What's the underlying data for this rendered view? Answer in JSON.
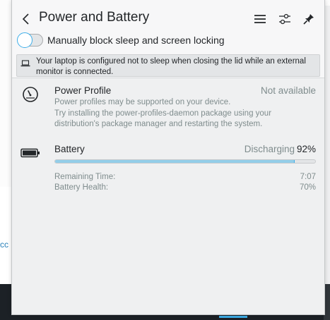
{
  "background": {
    "left_text": "cc"
  },
  "header": {
    "title": "Power and Battery",
    "back_icon": "chevron-left-icon",
    "menu_icon": "hamburger-menu-icon",
    "configure_icon": "configure-sliders-icon",
    "pin_icon": "pin-icon"
  },
  "inhibit_toggle": {
    "label": "Manually block sleep and screen locking",
    "checked": false
  },
  "notice": {
    "icon": "laptop-icon",
    "text": "Your laptop is configured not to sleep when closing the lid while an external monitor is connected."
  },
  "power_profile": {
    "icon": "speedometer-icon",
    "title": "Power Profile",
    "status": "Not available",
    "description_line1": "Power profiles may be supported on your device.",
    "description_line2": "Try installing the power-profiles-daemon package using your distribution's package manager and restarting the system."
  },
  "battery": {
    "icon": "battery-icon",
    "title": "Battery",
    "status": "Discharging",
    "percent_text": "92%",
    "charge_fraction": 0.92,
    "details": [
      {
        "label": "Remaining Time:",
        "value": "7:07"
      },
      {
        "label": "Battery Health:",
        "value": "70%"
      }
    ]
  },
  "colors": {
    "accent": "#3daee9",
    "progress_fill": "#93cee9",
    "background": "#eff0f1",
    "muted_text": "#7f8c8d"
  }
}
